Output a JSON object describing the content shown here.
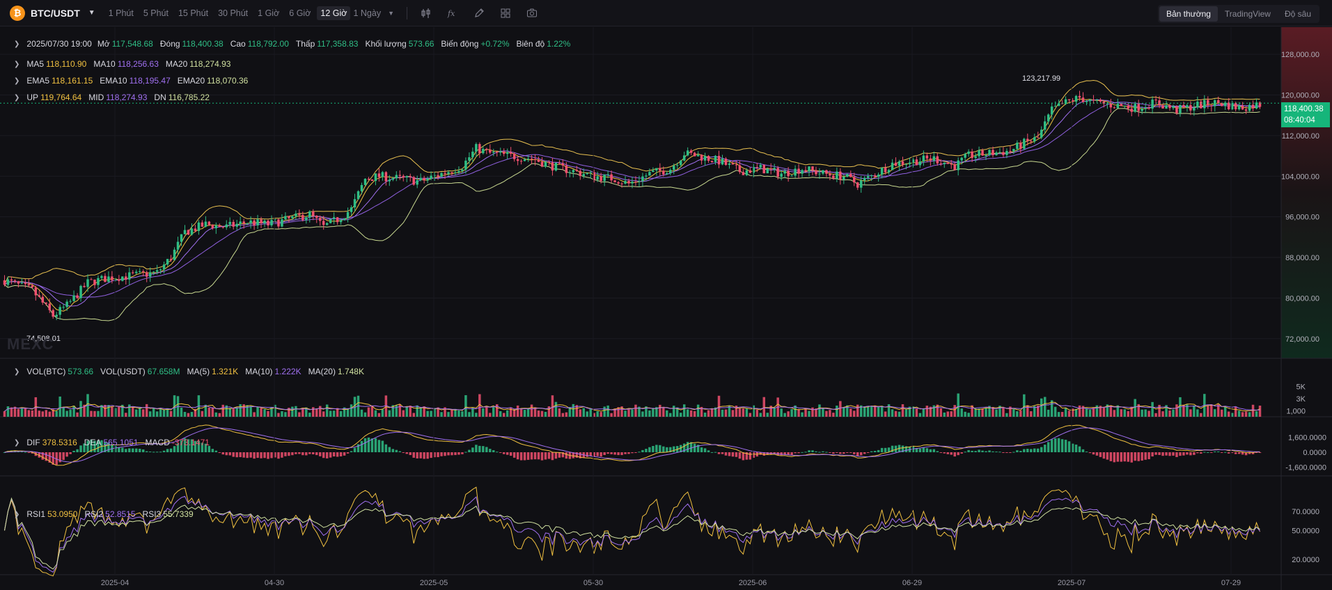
{
  "header": {
    "symbol": "BTC/USDT",
    "coin_glyph": "₿",
    "timeframes": [
      "1 Phút",
      "5 Phút",
      "15 Phút",
      "30 Phút",
      "1 Giờ",
      "6 Giờ",
      "12 Giờ"
    ],
    "active_timeframe": "12 Giờ",
    "more_timeframe": "1 Ngày",
    "tools": [
      "candle-type-icon",
      "indicator-fx-icon",
      "draw-pen-icon",
      "layout-grid-icon",
      "camera-icon"
    ],
    "views": [
      "Bản thường",
      "TradingView",
      "Độ sâu"
    ],
    "active_view": "Bản thường"
  },
  "ohlc": {
    "date": "2025/07/30 19:00",
    "open_label": "Mở",
    "open": "117,548.68",
    "close_label": "Đóng",
    "close": "118,400.38",
    "high_label": "Cao",
    "high": "118,792.00",
    "low_label": "Thấp",
    "low": "117,358.83",
    "volume_label": "Khối lượng",
    "volume": "573.66",
    "change_label": "Biến động",
    "change": "+0.72%",
    "amp_label": "Biên độ",
    "amp": "1.22%"
  },
  "ma": {
    "ma5_label": "MA5",
    "ma5": "118,110.90",
    "ma10_label": "MA10",
    "ma10": "118,256.63",
    "ma20_label": "MA20",
    "ma20": "118,274.93"
  },
  "ema": {
    "ema5_label": "EMA5",
    "ema5": "118,161.15",
    "ema10_label": "EMA10",
    "ema10": "118,195.47",
    "ema20_label": "EMA20",
    "ema20": "118,070.36"
  },
  "boll": {
    "up_label": "UP",
    "up": "119,764.64",
    "mid_label": "MID",
    "mid": "118,274.93",
    "dn_label": "DN",
    "dn": "116,785.22"
  },
  "vol": {
    "btc_label": "VOL(BTC)",
    "btc": "573.66",
    "usdt_label": "VOL(USDT)",
    "usdt": "67.658M",
    "ma5_label": "MA(5)",
    "ma5": "1.321K",
    "ma10_label": "MA(10)",
    "ma10": "1.222K",
    "ma20_label": "MA(20)",
    "ma20": "1.748K"
  },
  "macd": {
    "dif_label": "DIF",
    "dif": "378.5316",
    "dea_label": "DEA",
    "dea": "565.1051",
    "macd_label": "MACD",
    "macd": "-373.1471"
  },
  "rsi": {
    "rsi1_label": "RSI1",
    "rsi1": "53.0950",
    "rsi2_label": "RSI2",
    "rsi2": "52.8515",
    "rsi3_label": "RSI3",
    "rsi3": "55.7339"
  },
  "last_price": {
    "price": "118,400.38",
    "countdown": "08:40:04"
  },
  "high_marker": "123,217.99",
  "low_marker": "74,508.01",
  "watermark": "MEXC",
  "colors": {
    "up": "#2fbd85",
    "down": "#f0506e",
    "ma5": "#f0c040",
    "ma10": "#a070f0",
    "ma20": "#d0e0a0",
    "accent": "#16b57a"
  },
  "chart_data": {
    "type": "candlestick",
    "price_axis": [
      "128,000.00",
      "120,000.00",
      "112,000.00",
      "104,000.00",
      "96,000.00",
      "88,000.00",
      "80,000.00",
      "72,000.00"
    ],
    "price_range": [
      69500,
      132000
    ],
    "vol_axis": [
      "5K",
      "3K",
      "1,000"
    ],
    "macd_axis": [
      "1,600.0000",
      "0.0000",
      "-1,600.0000"
    ],
    "rsi_axis": [
      "70.0000",
      "50.0000",
      "20.0000"
    ],
    "x_labels": [
      "2025-04",
      "04-30",
      "2025-05",
      "05-30",
      "2025-06",
      "06-29",
      "2025-07",
      "07-29"
    ],
    "price_anchors": [
      [
        0,
        83500
      ],
      [
        8,
        81500
      ],
      [
        14,
        76500
      ],
      [
        18,
        78500
      ],
      [
        24,
        83000
      ],
      [
        30,
        84000
      ],
      [
        38,
        84500
      ],
      [
        44,
        85000
      ],
      [
        48,
        88000
      ],
      [
        52,
        93000
      ],
      [
        58,
        94500
      ],
      [
        64,
        94000
      ],
      [
        70,
        95000
      ],
      [
        76,
        94500
      ],
      [
        82,
        95500
      ],
      [
        88,
        96500
      ],
      [
        92,
        94000
      ],
      [
        96,
        95500
      ],
      [
        100,
        97500
      ],
      [
        104,
        103500
      ],
      [
        108,
        104000
      ],
      [
        114,
        103500
      ],
      [
        120,
        103000
      ],
      [
        126,
        104500
      ],
      [
        132,
        106000
      ],
      [
        136,
        109500
      ],
      [
        140,
        108500
      ],
      [
        146,
        108000
      ],
      [
        152,
        107500
      ],
      [
        158,
        106000
      ],
      [
        164,
        105000
      ],
      [
        170,
        104000
      ],
      [
        176,
        103500
      ],
      [
        180,
        102500
      ],
      [
        186,
        104500
      ],
      [
        192,
        105500
      ],
      [
        196,
        108500
      ],
      [
        200,
        108000
      ],
      [
        206,
        107000
      ],
      [
        212,
        105000
      ],
      [
        218,
        105500
      ],
      [
        224,
        104500
      ],
      [
        230,
        105500
      ],
      [
        236,
        104500
      ],
      [
        242,
        104000
      ],
      [
        246,
        102500
      ],
      [
        250,
        104000
      ],
      [
        256,
        106500
      ],
      [
        262,
        107000
      ],
      [
        268,
        107500
      ],
      [
        274,
        106000
      ],
      [
        278,
        108000
      ],
      [
        284,
        108500
      ],
      [
        290,
        109000
      ],
      [
        294,
        110500
      ],
      [
        298,
        111500
      ],
      [
        302,
        117000
      ],
      [
        306,
        118500
      ],
      [
        310,
        119500
      ],
      [
        314,
        118500
      ],
      [
        320,
        118000
      ],
      [
        326,
        117500
      ],
      [
        332,
        118500
      ],
      [
        338,
        117000
      ],
      [
        344,
        118000
      ],
      [
        350,
        118500
      ],
      [
        356,
        117500
      ],
      [
        362,
        118200
      ]
    ],
    "candle_count": 363
  }
}
